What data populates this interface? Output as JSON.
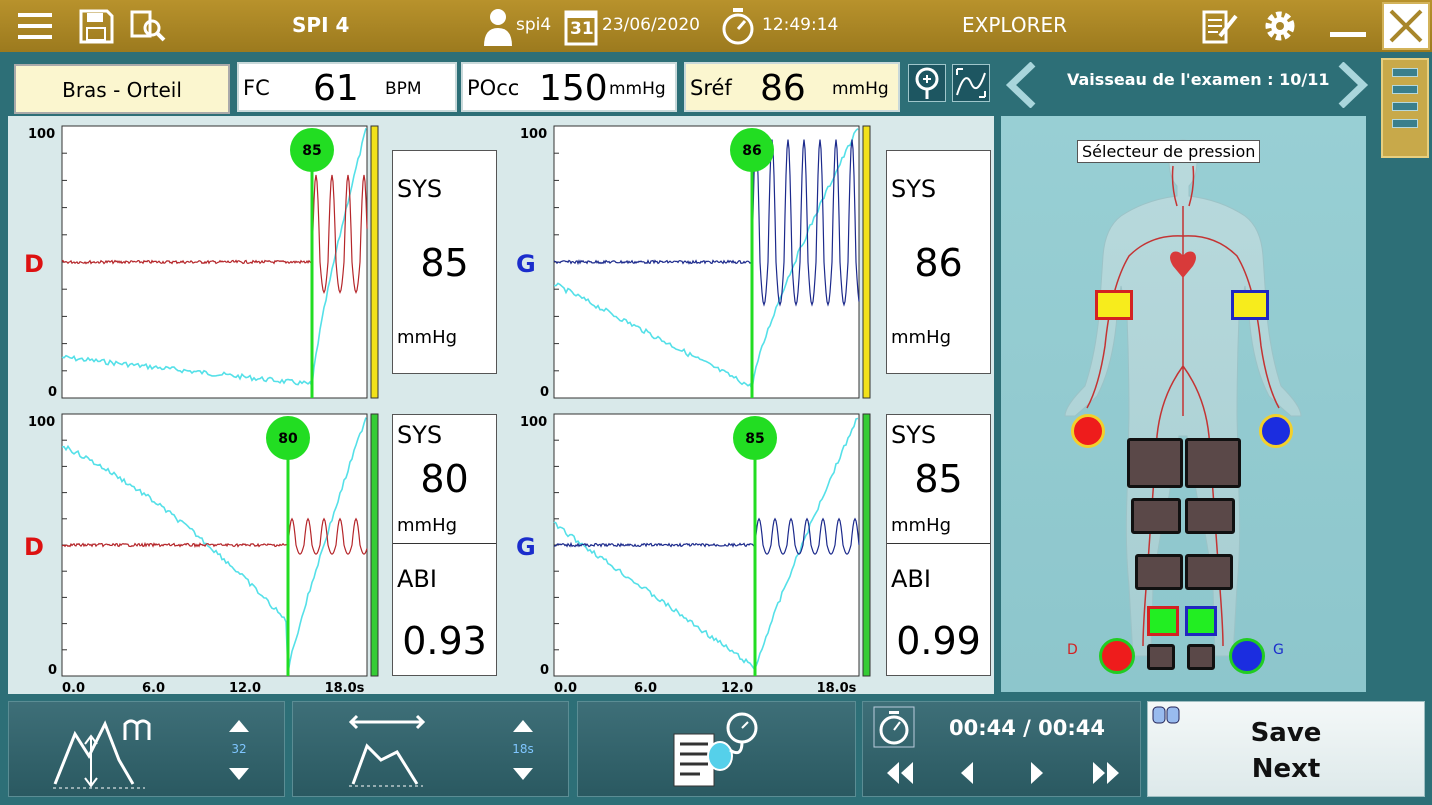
{
  "app": {
    "title": "SPI 4",
    "user": "spi4",
    "date": "23/06/2020",
    "date_day": "31",
    "time": "12:49:14",
    "mode": "EXPLORER"
  },
  "header": {
    "position_label": "Bras - Orteil",
    "fc_label": "FC",
    "fc_value": "61",
    "fc_unit": "BPM",
    "pocc_label": "POcc",
    "pocc_value": "150",
    "pocc_unit": "mmHg",
    "sref_label": "Sréf",
    "sref_value": "86",
    "sref_unit": "mmHg"
  },
  "vessel": {
    "label": "Vaisseau de l'examen : 10/11"
  },
  "pressure_selector": {
    "label": "Sélecteur de pression",
    "left_letter": "D",
    "right_letter": "G"
  },
  "charts": {
    "y_max": "100",
    "y_min": "0",
    "x_ticks": [
      "0.0",
      "6.0",
      "12.0",
      "18.0s"
    ],
    "top_left": {
      "side": "D",
      "marker": "85",
      "sys_label": "SYS",
      "sys_value": "85",
      "unit": "mmHg"
    },
    "top_right": {
      "side": "G",
      "marker": "86",
      "sys_label": "SYS",
      "sys_value": "86",
      "unit": "mmHg"
    },
    "bottom_left": {
      "side": "D",
      "marker": "80",
      "sys_label": "SYS",
      "sys_value": "80",
      "unit": "mmHg",
      "abi_label": "ABI",
      "abi_value": "0.93"
    },
    "bottom_right": {
      "side": "G",
      "marker": "85",
      "sys_label": "SYS",
      "sys_value": "85",
      "unit": "mmHg",
      "abi_label": "ABI",
      "abi_value": "0.99"
    }
  },
  "bottom": {
    "gain_value": "32",
    "time_scale": "18s",
    "timer": "00:44 / 00:44",
    "save_line1": "Save",
    "save_line2": "Next"
  },
  "colors": {
    "topbar": "#a8862a",
    "panel": "#d9e9ea",
    "right_trace": "#b5262a",
    "left_trace": "#1c2a8c",
    "pressure_trace": "#55e0e8",
    "marker": "#22dd22"
  },
  "icons": [
    "hamburger-icon",
    "save-icon",
    "search-report-icon",
    "user-icon",
    "calendar-icon",
    "stopwatch-icon",
    "report-edit-icon",
    "gear-icon",
    "minimize-icon",
    "close-icon",
    "zoom-icon",
    "fit-curve-icon",
    "chevron-left-icon",
    "chevron-right-icon",
    "menu-list-icon"
  ]
}
